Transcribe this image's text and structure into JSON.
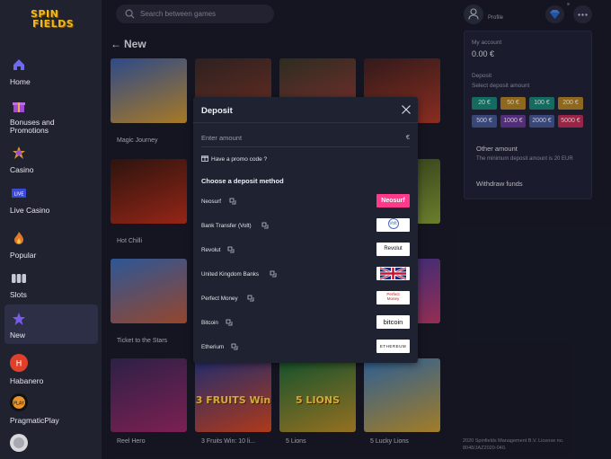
{
  "brand": {
    "line1": "SPIN",
    "line2": "FIELDS",
    "color": "#f2b71a"
  },
  "search": {
    "placeholder": "Search between games"
  },
  "profile": {
    "label": "Profile"
  },
  "sidebar": {
    "items": [
      {
        "label": "Home",
        "icon": "home-icon"
      },
      {
        "label": "Bonuses and Promotions",
        "icon": "gift-icon"
      },
      {
        "label": "Casino",
        "icon": "casino-star-icon"
      },
      {
        "label": "Live Casino",
        "icon": "live-icon",
        "badge": "LIVE"
      },
      {
        "label": "Popular",
        "icon": "flame-icon"
      },
      {
        "label": "Slots",
        "icon": "slots-icon"
      },
      {
        "label": "New",
        "icon": "star-icon"
      },
      {
        "label": "Habanero",
        "icon": "habanero-logo"
      },
      {
        "label": "PragmaticPlay",
        "icon": "pragmatic-logo"
      }
    ]
  },
  "section": {
    "title": "New"
  },
  "games": [
    {
      "name": "Magic Journey",
      "colorA": "#3b5fb0",
      "colorB": "#d79b2f"
    },
    {
      "name": "",
      "colorA": "#3a2b2b",
      "colorB": "#8a3a2a"
    },
    {
      "name": "",
      "colorA": "#3a3a2a",
      "colorB": "#a23a3a"
    },
    {
      "name": "",
      "colorA": "#402222",
      "colorB": "#b23a2a"
    },
    {
      "name": "Hot Chilli",
      "colorA": "#3a1a12",
      "colorB": "#c0301e"
    },
    {
      "name": "",
      "colorA": "#2a2430",
      "colorB": "#3a3050"
    },
    {
      "name": "",
      "colorA": "#2a2430",
      "colorB": "#3a3050"
    },
    {
      "name": "",
      "colorA": "#3b4a20",
      "colorB": "#8aa23a"
    },
    {
      "name": "Ticket to the Stars",
      "colorA": "#3a6fc0",
      "colorB": "#c05a3a"
    },
    {
      "name": "",
      "colorA": "#2a2430",
      "colorB": "#3a3050"
    },
    {
      "name": "",
      "colorA": "#2a2430",
      "colorB": "#3a3050"
    },
    {
      "name": "",
      "colorA": "#3a3aa0",
      "colorB": "#c03a6a"
    },
    {
      "name": "Reel Hero",
      "colorA": "#3a2a5a",
      "colorB": "#a02a6a"
    },
    {
      "name": "3 Fruits Win: 10 li...",
      "colorA": "#2a3a90",
      "colorB": "#e04a20",
      "art": "3 FRUITS Win"
    },
    {
      "name": "5 Lions",
      "colorA": "#1a6a3a",
      "colorB": "#c0902a",
      "art": "5 LIONS"
    },
    {
      "name": "5 Lucky Lions",
      "colorA": "#3a7ac0",
      "colorB": "#d0a030"
    }
  ],
  "account_panel": {
    "my_account_label": "My account",
    "balance": "0.00 €",
    "deposit_label": "Deposit",
    "select_label": "Select deposit amount",
    "amounts": [
      {
        "label": "20 €",
        "color": "#1c8a7a"
      },
      {
        "label": "50 €",
        "color": "#b8862a"
      },
      {
        "label": "100 €",
        "color": "#1c8a7a"
      },
      {
        "label": "200 €",
        "color": "#b8862a"
      },
      {
        "label": "500 €",
        "color": "#4a5a9a"
      },
      {
        "label": "1000 €",
        "color": "#6a3a9a"
      },
      {
        "label": "2000 €",
        "color": "#4a5a9a"
      },
      {
        "label": "5000 €",
        "color": "#c0305a"
      }
    ],
    "other_amount": "Other amount",
    "min_note": "The minimum deposit amount is 20 EUR",
    "withdraw": "Withdraw funds"
  },
  "footer_legal": "2020 Spinfields Management B.V. License no. 8048/JAZ2020-040.",
  "modal": {
    "title": "Deposit",
    "amount_placeholder": "Enter amount",
    "currency": "€",
    "promo": "Have a promo code ?",
    "choose": "Choose a deposit method",
    "methods": [
      {
        "name": "Neosurf",
        "logo_text": "Neosurf",
        "logo_bg": "#ff3a8a",
        "logo_fg": "#ffffff"
      },
      {
        "name": "Bank Transfer (Volt)",
        "logo_text": "Volt",
        "logo_bg": "#ffffff",
        "logo_fg": "#4a6ac0"
      },
      {
        "name": "Revolut",
        "logo_text": "Revolut",
        "logo_bg": "#ffffff",
        "logo_fg": "#111111"
      },
      {
        "name": "United Kingdom Banks",
        "logo_text": "",
        "logo_bg": "#ffffff",
        "logo_fg": "#111111"
      },
      {
        "name": "Perfect Money",
        "logo_text": "Perfect Money",
        "logo_bg": "#ffffff",
        "logo_fg": "#c01a1a"
      },
      {
        "name": "Bitcoin",
        "logo_text": "bitcoin",
        "logo_bg": "#ffffff",
        "logo_fg": "#111111"
      },
      {
        "name": "Etherium",
        "logo_text": "ETHEREUM",
        "logo_bg": "#ffffff",
        "logo_fg": "#111111"
      }
    ]
  }
}
